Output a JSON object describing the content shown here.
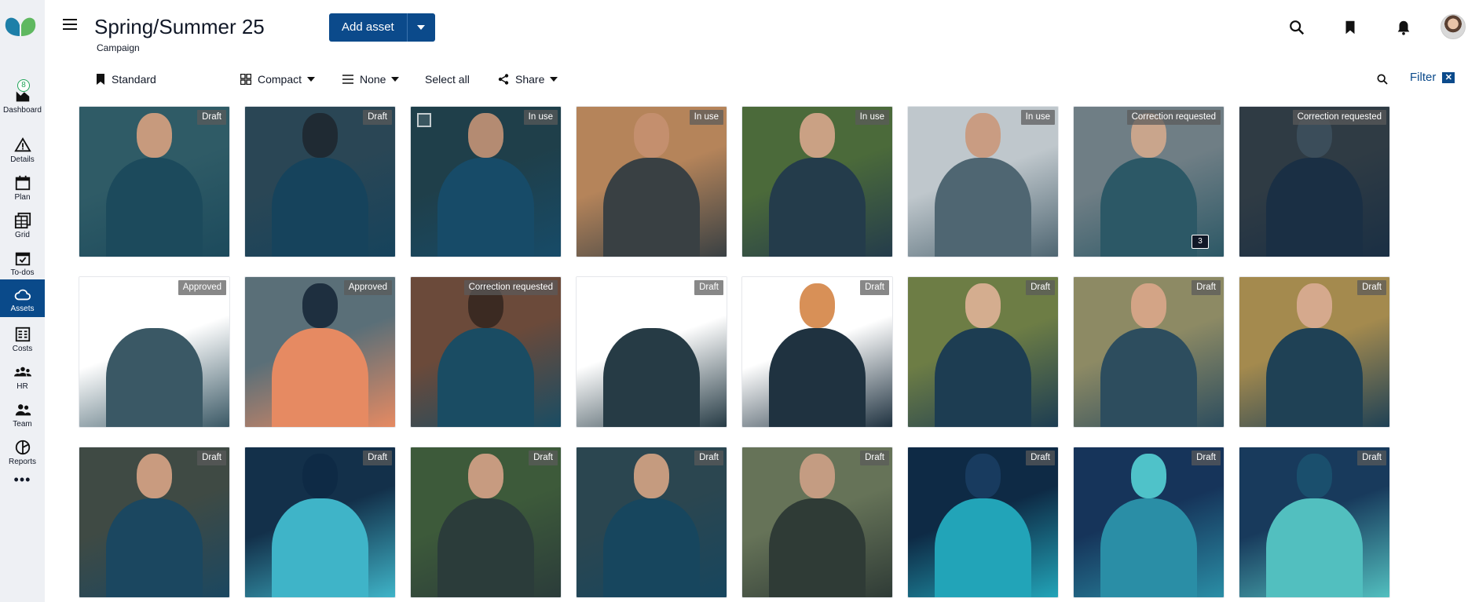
{
  "nav": {
    "items": [
      {
        "label": "Dashboard",
        "icon": "dashboard-icon",
        "badge": "8"
      },
      {
        "label": "Details",
        "icon": "warning-triangle-icon"
      },
      {
        "label": "Plan",
        "icon": "calendar-icon"
      },
      {
        "label": "Grid",
        "icon": "grid-icon"
      },
      {
        "label": "To-dos",
        "icon": "todo-calendar-icon"
      },
      {
        "label": "Assets",
        "icon": "cloud-icon",
        "active": true
      },
      {
        "label": "Costs",
        "icon": "costs-icon"
      },
      {
        "label": "HR",
        "icon": "hr-icon"
      },
      {
        "label": "Team",
        "icon": "team-icon"
      },
      {
        "label": "Reports",
        "icon": "reports-icon"
      }
    ],
    "more": "•••"
  },
  "header": {
    "title": "Spring/Summer 25",
    "subtitle": "Campaign",
    "add_asset_label": "Add asset"
  },
  "toolbar": {
    "view_label": "Standard",
    "density_label": "Compact",
    "group_label": "None",
    "select_all_label": "Select all",
    "share_label": "Share",
    "filter_label": "Filter",
    "filter_clear": "✕"
  },
  "colors": {
    "accent": "#0b4a8b",
    "rail_bg": "#eef0f4"
  },
  "assets": [
    {
      "status": "Draft"
    },
    {
      "status": "Draft"
    },
    {
      "status": "In use",
      "selectable": true
    },
    {
      "status": "In use"
    },
    {
      "status": "In use"
    },
    {
      "status": "In use"
    },
    {
      "status": "Correction requested",
      "comments": "3"
    },
    {
      "status": "Correction requested"
    },
    {
      "status": "Approved"
    },
    {
      "status": "Approved"
    },
    {
      "status": "Correction requested"
    },
    {
      "status": "Draft"
    },
    {
      "status": "Draft"
    },
    {
      "status": "Draft"
    },
    {
      "status": "Draft"
    },
    {
      "status": "Draft"
    },
    {
      "status": "Draft"
    },
    {
      "status": "Draft"
    },
    {
      "status": "Draft"
    },
    {
      "status": "Draft"
    },
    {
      "status": "Draft"
    },
    {
      "status": "Draft"
    },
    {
      "status": "Draft"
    },
    {
      "status": "Draft"
    }
  ]
}
